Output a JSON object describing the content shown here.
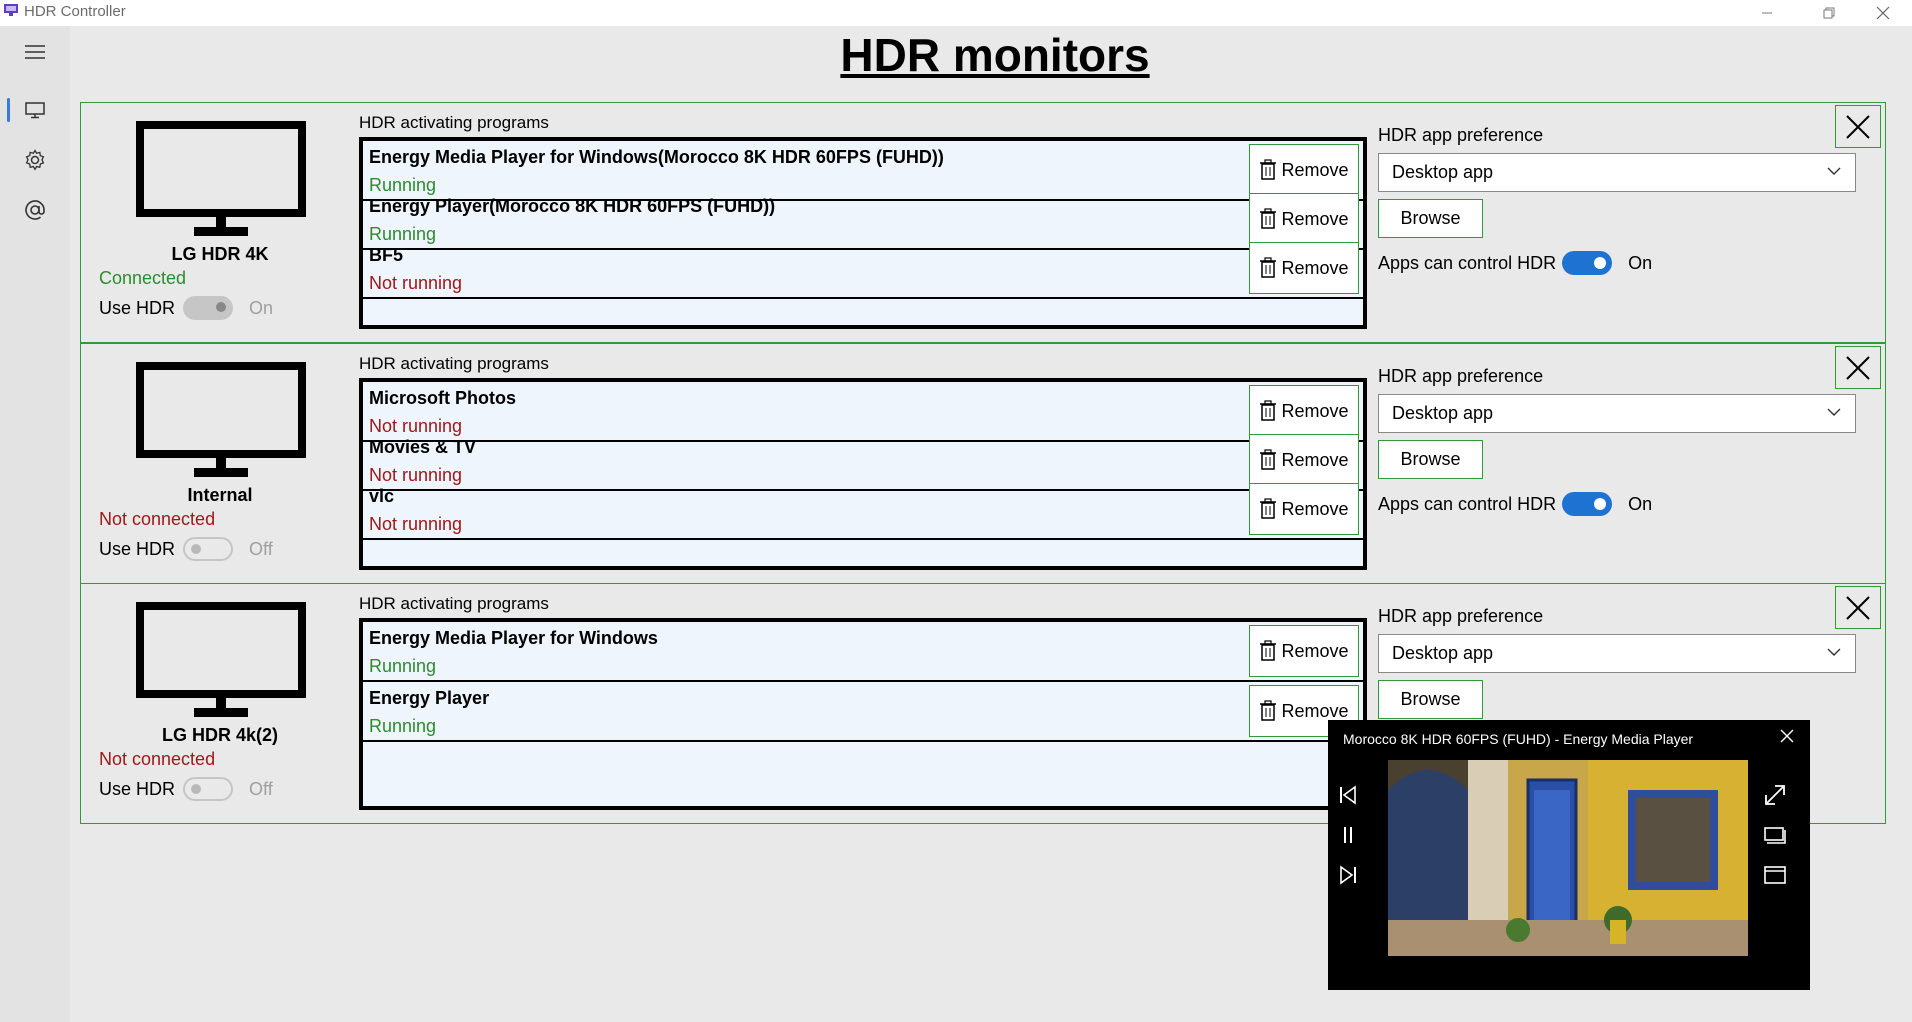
{
  "window": {
    "title": "HDR Controller",
    "controls": [
      "minimize",
      "restore",
      "close"
    ]
  },
  "nav": {
    "items": [
      {
        "icon": "hamburger-icon"
      },
      {
        "icon": "monitor-icon",
        "active": true
      },
      {
        "icon": "gear-icon"
      },
      {
        "icon": "at-icon"
      }
    ]
  },
  "page": {
    "title": "HDR monitors"
  },
  "monitors": [
    {
      "name": "LG HDR 4K",
      "connection": "Connected",
      "use_hdr_label": "Use HDR",
      "use_hdr_state": "On",
      "programs_heading": "HDR activating programs",
      "programs": [
        {
          "name": "Energy Media Player for Windows(Morocco 8K HDR 60FPS (FUHD))",
          "status": "Running"
        },
        {
          "name": "Energy Player(Morocco 8K HDR 60FPS (FUHD))",
          "status": "Running"
        },
        {
          "name": "BF5",
          "status": "Not running"
        }
      ],
      "remove_label": "Remove",
      "pref_label": "HDR app preference",
      "pref_value": "Desktop app",
      "browse_label": "Browse",
      "apps_control_label": "Apps can control HDR",
      "apps_control_state": "On"
    },
    {
      "name": "Internal",
      "connection": "Not connected",
      "use_hdr_label": "Use HDR",
      "use_hdr_state": "Off",
      "programs_heading": "HDR activating programs",
      "programs": [
        {
          "name": "Microsoft Photos",
          "status": "Not running"
        },
        {
          "name": "Movies & TV",
          "status": "Not running"
        },
        {
          "name": "vlc",
          "status": "Not running"
        }
      ],
      "remove_label": "Remove",
      "pref_label": "HDR app preference",
      "pref_value": "Desktop app",
      "browse_label": "Browse",
      "apps_control_label": "Apps can control HDR",
      "apps_control_state": "On"
    },
    {
      "name": "LG HDR 4k(2)",
      "connection": "Not connected",
      "use_hdr_label": "Use HDR",
      "use_hdr_state": "Off",
      "programs_heading": "HDR activating programs",
      "programs": [
        {
          "name": "Energy Media Player for Windows",
          "status": "Running"
        },
        {
          "name": "Energy Player",
          "status": "Running"
        }
      ],
      "remove_label": "Remove",
      "pref_label": "HDR app preference",
      "pref_value": "Desktop app",
      "browse_label": "Browse"
    }
  ],
  "mini_player": {
    "title": "Morocco 8K HDR 60FPS (FUHD) - Energy Media Player",
    "controls": [
      "previous-icon",
      "pause-icon",
      "next-icon",
      "expand-icon",
      "overlay-icon",
      "window-icon"
    ]
  },
  "colors": {
    "accent_green": "#2e9a3a",
    "running": "#2e8b2e",
    "not_running": "#a01818",
    "toggle_on": "#1e73d2"
  }
}
